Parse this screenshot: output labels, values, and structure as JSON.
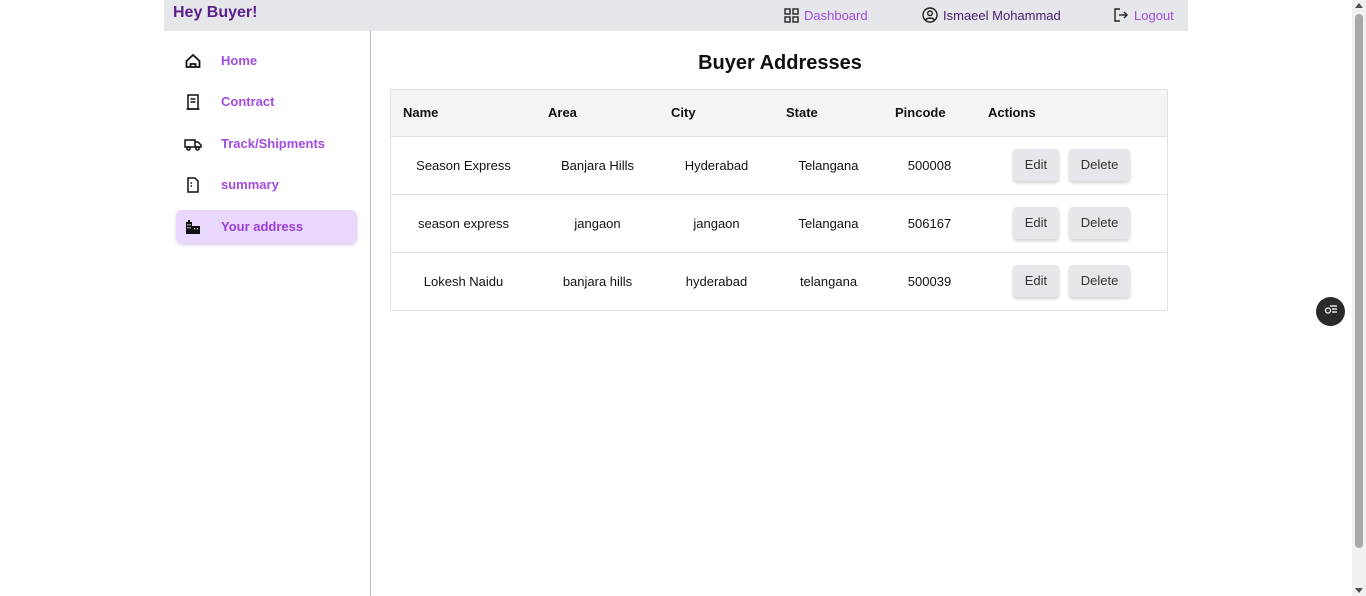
{
  "header": {
    "brand": "Hey Buyer!",
    "dashboard_label": "Dashboard",
    "user_name": "Ismaeel Mohammad",
    "logout_label": "Logout"
  },
  "sidebar": {
    "items": [
      {
        "label": "Home",
        "icon": "home-icon"
      },
      {
        "label": "Contract",
        "icon": "contract-icon"
      },
      {
        "label": "Track/Shipments",
        "icon": "truck-icon"
      },
      {
        "label": "summary",
        "icon": "summary-icon"
      },
      {
        "label": "Your address",
        "icon": "building-icon",
        "active": true
      }
    ]
  },
  "main": {
    "title": "Buyer Addresses",
    "columns": [
      "Name",
      "Area",
      "City",
      "State",
      "Pincode",
      "Actions"
    ],
    "rows": [
      {
        "name": "Season Express",
        "area": "Banjara Hills",
        "city": "Hyderabad",
        "state": "Telangana",
        "pincode": "500008"
      },
      {
        "name": "season express",
        "area": "jangaon",
        "city": "jangaon",
        "state": "Telangana",
        "pincode": "506167"
      },
      {
        "name": "Lokesh Naidu",
        "area": "banjara hills",
        "city": "hyderabad",
        "state": "telangana",
        "pincode": "500039"
      }
    ],
    "edit_label": "Edit",
    "delete_label": "Delete"
  },
  "colors": {
    "accent": "#a24bdf",
    "brand": "#5b1f8a",
    "active_bg": "#ead7fd",
    "topbar_bg": "#e5e7eb"
  }
}
